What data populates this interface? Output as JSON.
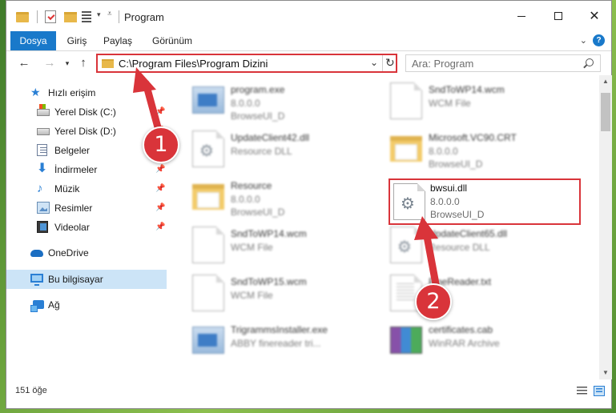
{
  "window": {
    "title": "Program"
  },
  "ribbon": {
    "tabs": [
      "Dosya",
      "Giriş",
      "Paylaş",
      "Görünüm"
    ]
  },
  "address": {
    "path": "C:\\Program Files\\Program Dizini"
  },
  "search": {
    "placeholder": "Ara: Program"
  },
  "sidebar": {
    "items": [
      {
        "label": "Hızlı erişim",
        "icon": "star-icon",
        "pinned": false
      },
      {
        "label": "Yerel Disk (C:)",
        "icon": "drive-icon",
        "pinned": true
      },
      {
        "label": "Yerel Disk (D:)",
        "icon": "drive-icon",
        "pinned": true
      },
      {
        "label": "Belgeler",
        "icon": "document-icon",
        "pinned": true
      },
      {
        "label": "İndirmeler",
        "icon": "download-icon",
        "pinned": true
      },
      {
        "label": "Müzik",
        "icon": "music-icon",
        "pinned": true
      },
      {
        "label": "Resimler",
        "icon": "pictures-icon",
        "pinned": true
      },
      {
        "label": "Videolar",
        "icon": "video-icon",
        "pinned": true
      },
      {
        "label": "OneDrive",
        "icon": "cloud-icon",
        "pinned": false
      },
      {
        "label": "Bu bilgisayar",
        "icon": "pc-icon",
        "pinned": false,
        "selected": true
      },
      {
        "label": "Ağ",
        "icon": "network-icon",
        "pinned": false
      }
    ]
  },
  "files": [
    {
      "name": "program.exe",
      "line2": "8.0.0.0",
      "line3": "BrowseUI_D",
      "icon": "exe-icon"
    },
    {
      "name": "SndToWP14.wcm",
      "line2": "WCM File",
      "line3": "",
      "icon": "page-icon"
    },
    {
      "name": "UpdateClient42.dll",
      "line2": "Resource DLL",
      "line3": "",
      "icon": "gear-page-icon"
    },
    {
      "name": "Microsoft.VC90.CRT",
      "line2": "8.0.0.0",
      "line3": "BrowseUI_D",
      "icon": "folder-icon"
    },
    {
      "name": "Resource",
      "line2": "8.0.0.0",
      "line3": "BrowseUI_D",
      "icon": "folder-icon"
    },
    {
      "name": "bwsui.dll",
      "line2": "8.0.0.0",
      "line3": "BrowseUI_D",
      "icon": "gear-page-icon",
      "highlighted": true
    },
    {
      "name": "SndToWP14.wcm",
      "line2": "WCM File",
      "line3": "",
      "icon": "page-icon"
    },
    {
      "name": "UpdateClient65.dll",
      "line2": "Resource DLL",
      "line3": "",
      "icon": "gear-page-icon"
    },
    {
      "name": "SndToWP15.wcm",
      "line2": "WCM File",
      "line3": "",
      "icon": "page-icon"
    },
    {
      "name": "FineReader.txt",
      "line2": "",
      "line3": "",
      "icon": "text-page-icon"
    },
    {
      "name": "TrigrammsInstaller.exe",
      "line2": "ABBY finereader tri...",
      "line3": "",
      "icon": "exe-icon"
    },
    {
      "name": "certificates.cab",
      "line2": "WinRAR Archive",
      "line3": "",
      "icon": "winrar-icon"
    }
  ],
  "status": {
    "count": "151 öğe"
  },
  "annotations": {
    "badge1": "1",
    "badge2": "2",
    "accent": "#d9343a"
  },
  "colors": {
    "ribbon_file_tab": "#1979ca",
    "selection": "#cce4f7"
  }
}
